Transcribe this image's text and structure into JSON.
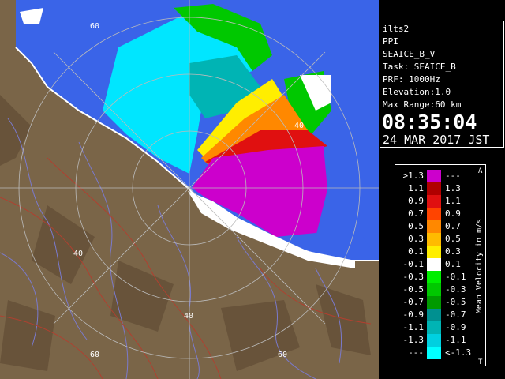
{
  "radar": {
    "range_ring_labels": [
      "60",
      "40",
      "40",
      "40",
      "40",
      "60",
      "60"
    ],
    "colors": {
      "land": "#7a6548",
      "land_dark": "#5a4630",
      "sea": "#3a64e8",
      "ring": "#bbbbbb",
      "river": "#7a7acc",
      "road": "#b04030",
      "coast": "#ffffff"
    }
  },
  "info": {
    "station": "ilts2",
    "product": "PPI",
    "task_name": "SEAICE_B_V",
    "task": "Task: SEAICE_B",
    "prf": "PRF: 1000Hz",
    "elevation": "Elevation:1.0",
    "max_range": "Max Range:60 km",
    "time": "08:35:04",
    "date": "24 MAR 2017 JST"
  },
  "legend": {
    "title": "Mean Velocity in m/s",
    "top_marker": "A",
    "bottom_marker": "T",
    "entries": [
      {
        "lo": ">1.3",
        "hi": "---",
        "color": "#cc00cc"
      },
      {
        "lo": "1.1",
        "hi": "1.3",
        "color": "#b00000"
      },
      {
        "lo": "0.9",
        "hi": "1.1",
        "color": "#e01010"
      },
      {
        "lo": "0.7",
        "hi": "0.9",
        "color": "#ff4400"
      },
      {
        "lo": "0.5",
        "hi": "0.7",
        "color": "#ff8800"
      },
      {
        "lo": "0.3",
        "hi": "0.5",
        "color": "#ffbb00"
      },
      {
        "lo": "0.1",
        "hi": "0.3",
        "color": "#ffee00"
      },
      {
        "lo": "-0.1",
        "hi": "0.1",
        "color": "#ffffff"
      },
      {
        "lo": "-0.3",
        "hi": "-0.1",
        "color": "#00ee00"
      },
      {
        "lo": "-0.5",
        "hi": "-0.3",
        "color": "#00c800"
      },
      {
        "lo": "-0.7",
        "hi": "-0.5",
        "color": "#009a00"
      },
      {
        "lo": "-0.9",
        "hi": "-0.7",
        "color": "#009090"
      },
      {
        "lo": "-1.1",
        "hi": "-0.9",
        "color": "#00b4b4"
      },
      {
        "lo": "-1.3",
        "hi": "-1.1",
        "color": "#00d0e0"
      },
      {
        "lo": "---",
        "hi": "<-1.3",
        "color": "#00ffff"
      }
    ]
  }
}
